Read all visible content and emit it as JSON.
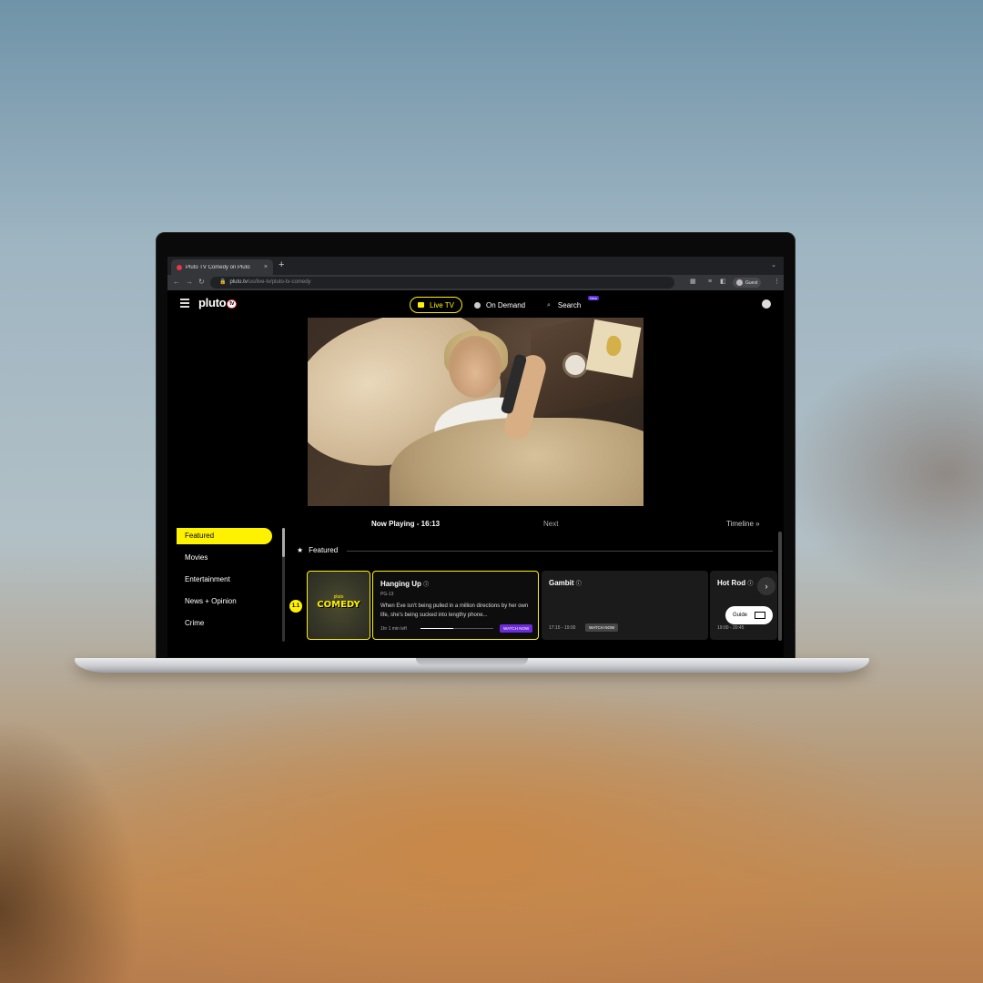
{
  "browser": {
    "tab_title": "Pluto TV Comedy on Pluto",
    "tab_close": "×",
    "new_tab": "+",
    "tab_menu": "⌄",
    "url_host": "pluto.tv",
    "url_path": "/us/live-tv/pluto-tv-comedy",
    "profile": "Guest"
  },
  "header": {
    "logo": "pluto",
    "logo_badge": "tv",
    "live_tv": "Live TV",
    "on_demand": "On Demand",
    "search": "Search",
    "new_badge": "New"
  },
  "guide": {
    "now_playing": "Now Playing - 16:13",
    "next": "Next",
    "timeline": "Timeline",
    "section": "Featured",
    "channel_number": "1.1",
    "thumb_brand": "pluto",
    "thumb_title": "COMEDY"
  },
  "sidebar": {
    "items": [
      {
        "label": "Featured"
      },
      {
        "label": "Movies"
      },
      {
        "label": "Entertainment"
      },
      {
        "label": "News + Opinion"
      },
      {
        "label": "Crime"
      }
    ]
  },
  "programs": [
    {
      "title": "Hanging Up",
      "rating": "PG-13",
      "description": "When Eve isn't being pulled in a million directions by her own life, she's being sucked into lengthy phone...",
      "time_left": "1hr 1 min left",
      "progress": 0.45,
      "cta": "WATCH NOW"
    },
    {
      "title": "Gambit",
      "time": "17:15 - 19:00",
      "cta": "WATCH NOW"
    },
    {
      "title": "Hot Rod",
      "time": "19:00 - 20:45"
    }
  ],
  "controls": {
    "guide_button": "Guide",
    "next_arrow": "›"
  }
}
